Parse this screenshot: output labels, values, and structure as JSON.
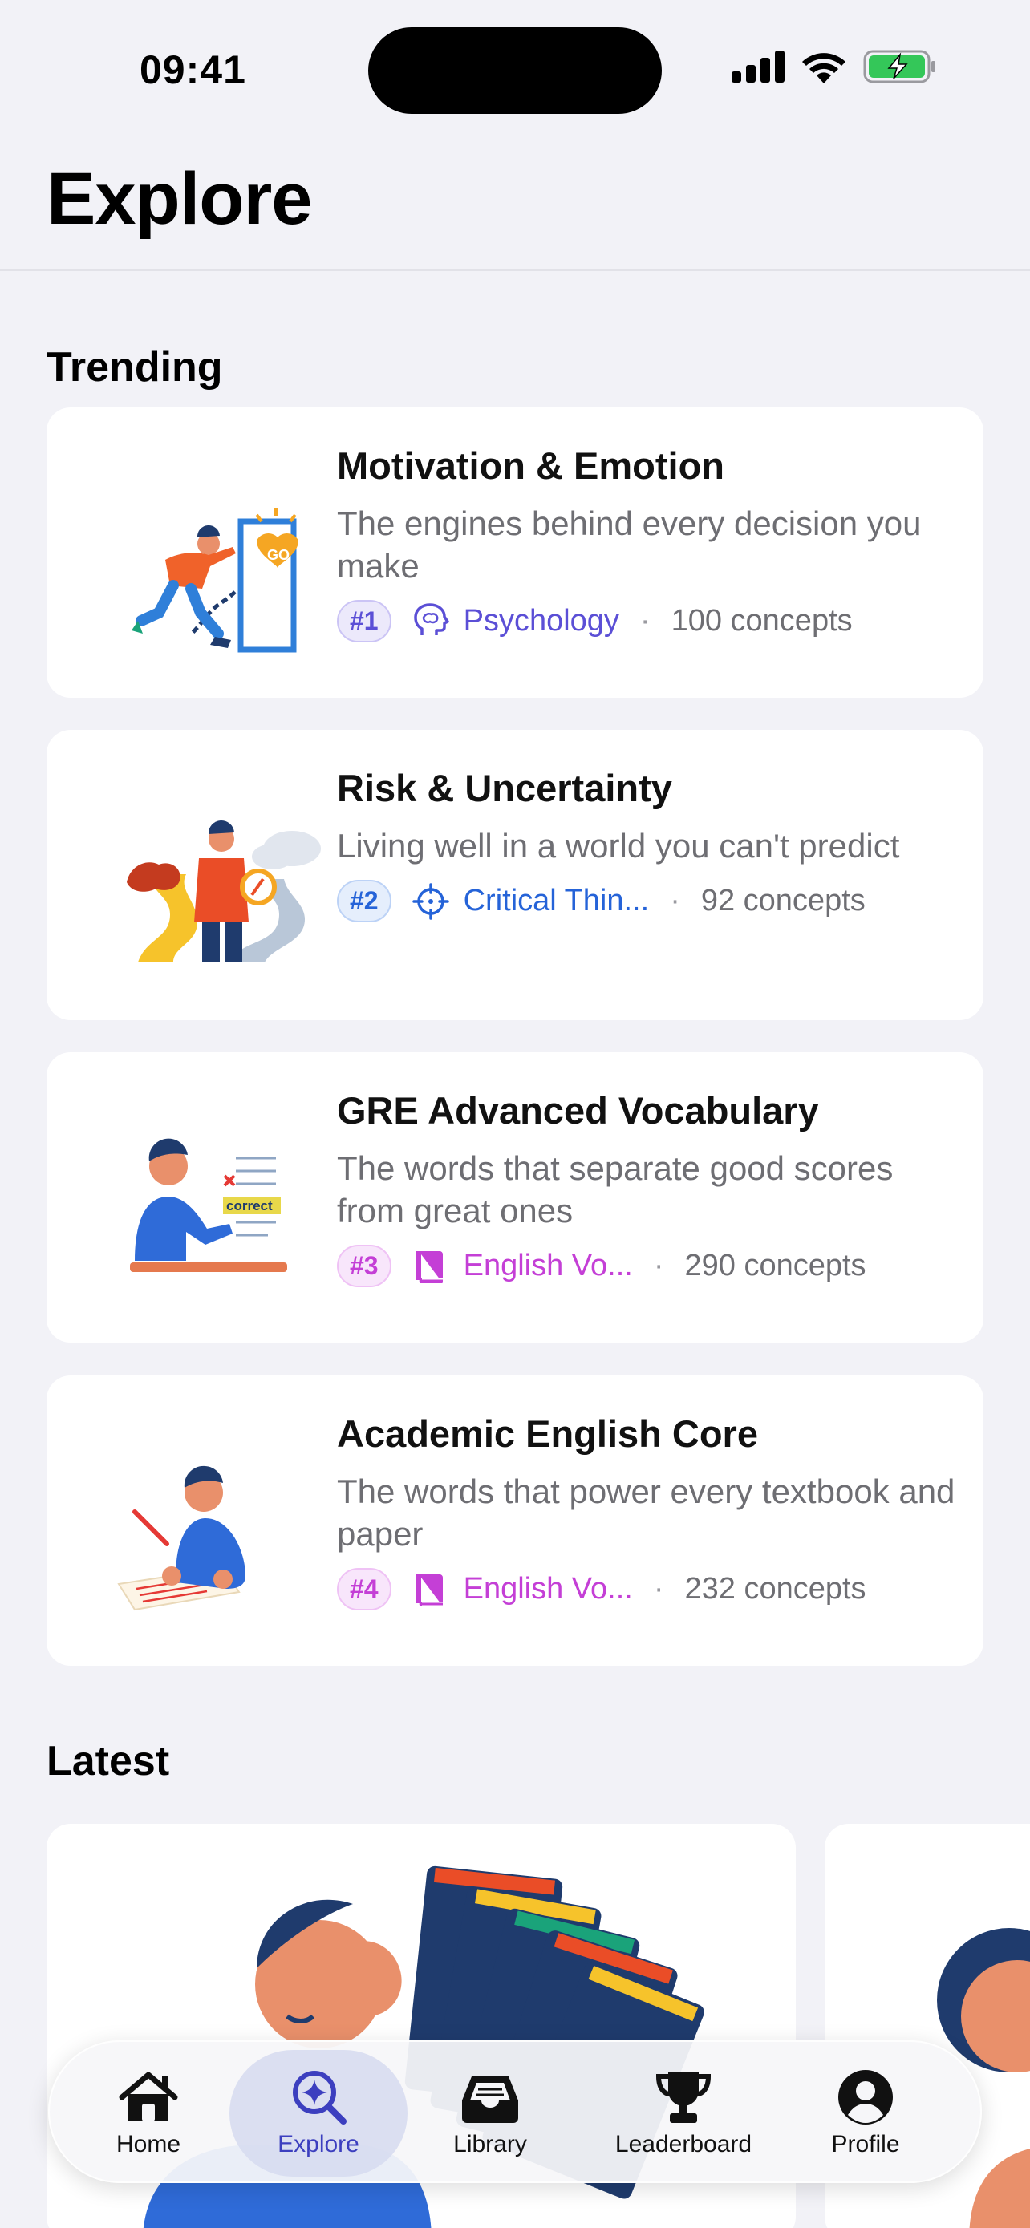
{
  "status": {
    "time": "09:41"
  },
  "header": {
    "title": "Explore"
  },
  "trending": {
    "title": "Trending",
    "items": [
      {
        "title": "Motivation & Emotion",
        "description": "The engines behind every decision you make",
        "rank": "#1",
        "category": "Psychology",
        "category_icon": "brain-icon",
        "concepts": "100 concepts",
        "accent": "#5b4fd6",
        "badge_bg": "#ece9fb"
      },
      {
        "title": "Risk & Uncertainty",
        "description": "Living well in a world you can't predict",
        "rank": "#2",
        "category": "Critical Thin...",
        "category_icon": "crosshair-icon",
        "concepts": "92 concepts",
        "accent": "#2563d8",
        "badge_bg": "#e5eefc"
      },
      {
        "title": "GRE Advanced Vocabulary",
        "description": "The words that separate good scores from great ones",
        "rank": "#3",
        "category": "English Vo...",
        "category_icon": "book-icon",
        "concepts": "290 concepts",
        "accent": "#c43fd6",
        "badge_bg": "#f8e6fb"
      },
      {
        "title": "Academic English Core",
        "description": "The words that power every textbook and paper",
        "rank": "#4",
        "category": "English Vo...",
        "category_icon": "book-icon",
        "concepts": "232 concepts",
        "accent": "#c43fd6",
        "badge_bg": "#f8e6fb"
      }
    ]
  },
  "latest": {
    "title": "Latest"
  },
  "tabbar": {
    "active": "Explore",
    "tabs": [
      {
        "label": "Home",
        "icon": "house-icon"
      },
      {
        "label": "Explore",
        "icon": "sparkle-search-icon"
      },
      {
        "label": "Library",
        "icon": "tray-icon"
      },
      {
        "label": "Leaderboard",
        "icon": "trophy-icon"
      },
      {
        "label": "Profile",
        "icon": "person-circle-icon"
      }
    ]
  }
}
